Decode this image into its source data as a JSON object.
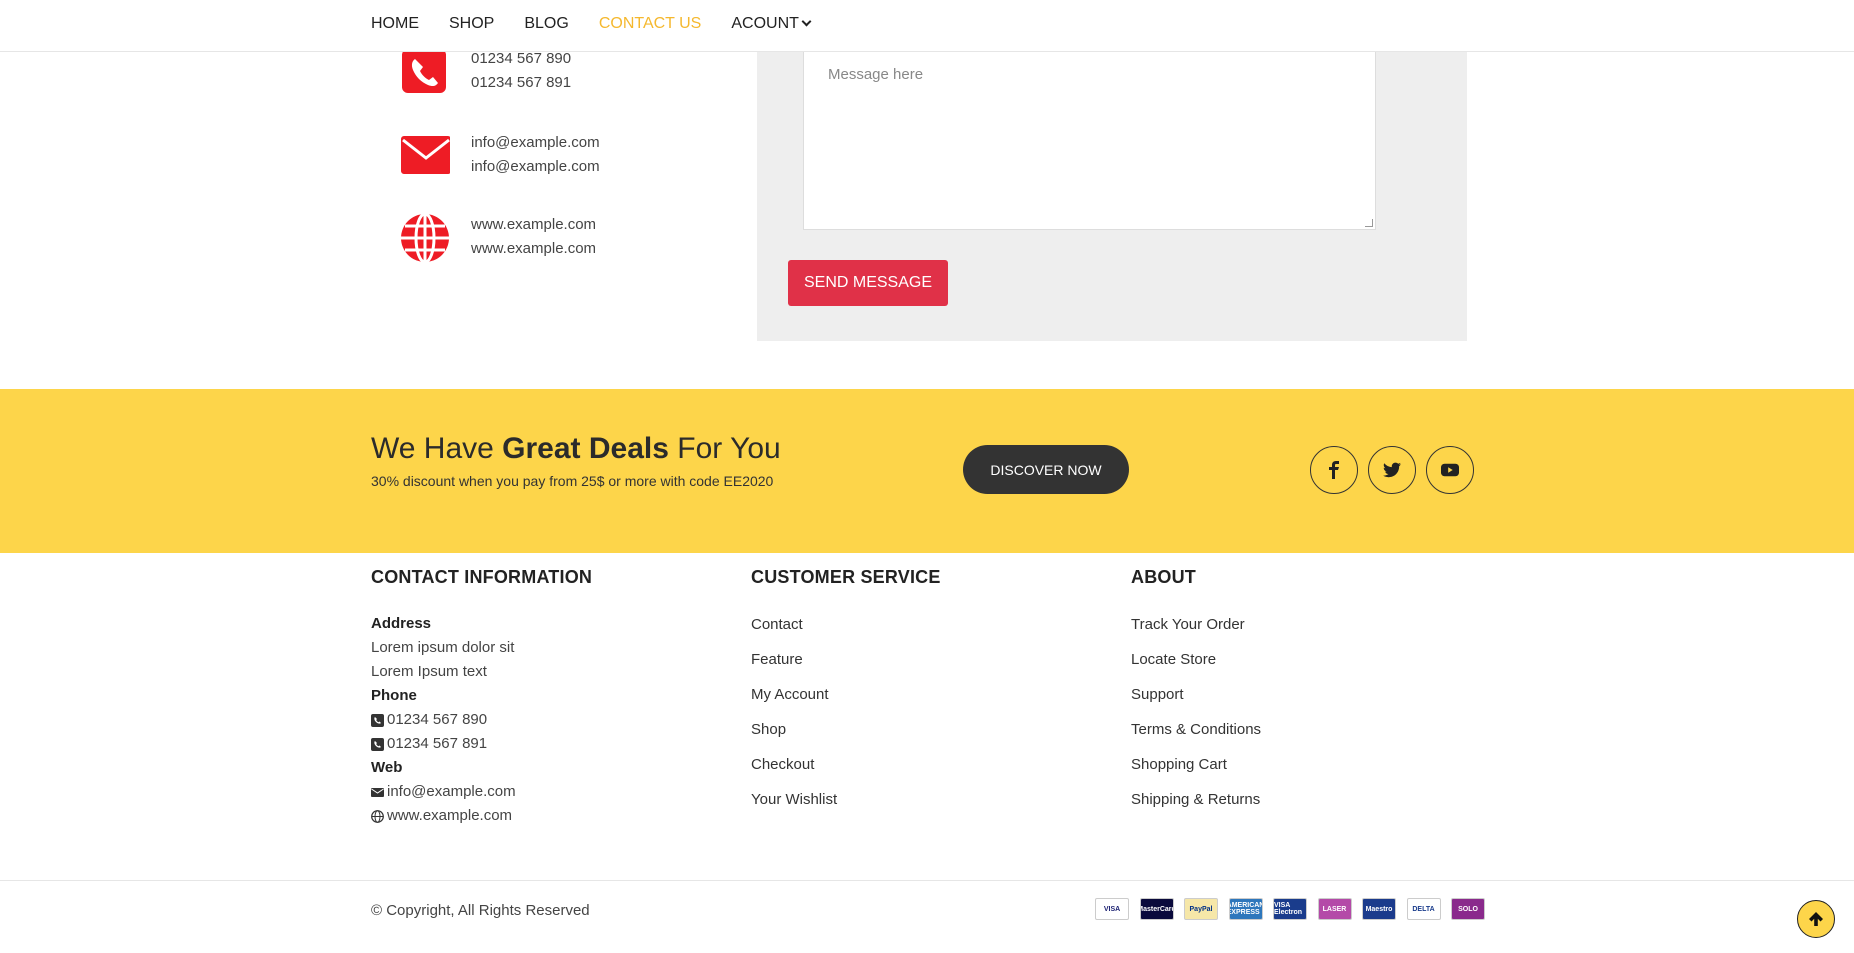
{
  "nav": {
    "items": [
      {
        "label": "HOME"
      },
      {
        "label": "SHOP"
      },
      {
        "label": "BLOG"
      },
      {
        "label": "CONTACT US",
        "active": true
      },
      {
        "label": "ACOUNT",
        "dropdown": true
      }
    ]
  },
  "contact_list": {
    "phone": {
      "icon": "phone-icon",
      "line1": "01234 567 890",
      "line2": "01234 567 891"
    },
    "email": {
      "icon": "envelope-icon",
      "line1": "info@example.com",
      "line2": "info@example.com"
    },
    "web": {
      "icon": "globe-icon",
      "line1": "www.example.com",
      "line2": "www.example.com"
    }
  },
  "form": {
    "message_placeholder": "Message here",
    "send_label": "SEND MESSAGE"
  },
  "deals": {
    "title_pre": "We Have ",
    "title_bold": "Great Deals",
    "title_post": " For You",
    "subtitle": "30% discount when you pay from 25$ or more with code EE2020",
    "button_label": "DISCOVER NOW",
    "social": [
      {
        "icon": "facebook-icon"
      },
      {
        "icon": "twitter-icon"
      },
      {
        "icon": "youtube-icon"
      }
    ]
  },
  "footer": {
    "contact": {
      "heading": "CONTACT INFORMATION",
      "address_label": "Address",
      "address1": "Lorem ipsum dolor sit",
      "address2": "Lorem Ipsum text",
      "phone_label": "Phone",
      "phone1": "01234 567 890",
      "phone2": "01234 567 891",
      "web_label": "Web",
      "email": "info@example.com",
      "website": "www.example.com"
    },
    "customer_service": {
      "heading": "CUSTOMER SERVICE",
      "links": [
        "Contact",
        "Feature",
        "My Account",
        "Shop",
        "Checkout",
        "Your Wishlist"
      ]
    },
    "about": {
      "heading": "ABOUT",
      "links": [
        "Track Your Order",
        "Locate Store",
        "Support",
        "Terms & Conditions",
        "Shopping Cart",
        "Shipping & Returns"
      ]
    },
    "copyright": "© Copyright, All Rights Reserved",
    "payment_cards": [
      {
        "name": "VISA",
        "bg": "#ffffff",
        "fg": "#1a1f71"
      },
      {
        "name": "MasterCard",
        "bg": "#0a0a3c",
        "fg": "#ffffff"
      },
      {
        "name": "PayPal",
        "bg": "#f6e7a8",
        "fg": "#003087"
      },
      {
        "name": "AMERICAN EXPRESS",
        "bg": "#2e77bc",
        "fg": "#ffffff"
      },
      {
        "name": "VISA Electron",
        "bg": "#1a3c8c",
        "fg": "#ffffff"
      },
      {
        "name": "LASER",
        "bg": "#b44aa8",
        "fg": "#ffffff"
      },
      {
        "name": "Maestro",
        "bg": "#1b3b8c",
        "fg": "#ffffff"
      },
      {
        "name": "DELTA",
        "bg": "#ffffff",
        "fg": "#1a3c8c"
      },
      {
        "name": "SOLO",
        "bg": "#8a2a8c",
        "fg": "#ffffff"
      }
    ]
  },
  "colors": {
    "accent_red": "#e03148",
    "icon_red": "#ee1c25",
    "banner_yellow": "#fdd54a",
    "nav_active": "#f5b82e"
  }
}
